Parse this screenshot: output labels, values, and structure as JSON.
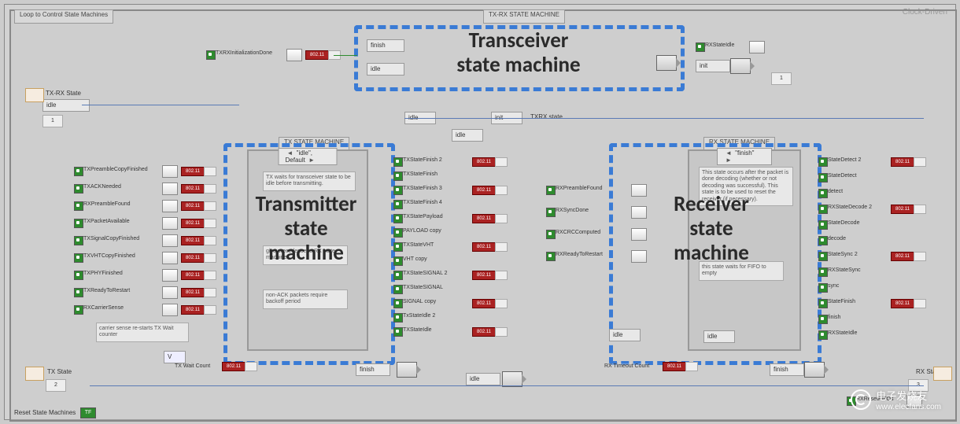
{
  "frame": {
    "title": "Loop to Control State Machines",
    "main_case": "TX-RX STATE MACHINE",
    "mode": "Clock-Driven"
  },
  "annotations": {
    "transceiver": "Transceiver\nstate machine",
    "transmitter": "Transmitter\nstate\nmachine",
    "receiver": "Receiver\nstate\nmachine"
  },
  "transceiver": {
    "input_bool": "TXRXInitializationDone",
    "out_label": "RXStateIdle",
    "finish": "finish",
    "idle": "idle",
    "init": "init"
  },
  "top_io": {
    "state_lbl": "TX-RX State",
    "state_val": "idle",
    "readout": "802.11"
  },
  "txrx_bus": {
    "label": "TXRX state",
    "idle1": "idle",
    "idle2": "idle",
    "init": "init"
  },
  "tx": {
    "case_label": "TX STATE MACHINE",
    "case_sel": "\"idle\", Default",
    "tx_state_lbl": "TX State",
    "wait_count": "TX Wait Count",
    "finish": "finish",
    "idle": "idle",
    "comment_top": "TX waits for transceiver state to be idle before transmitting.",
    "comment_mid": "give precedence to RX state machine",
    "comment_bot": "non-ACK packets require backoff period",
    "cs_comment": "carrier sense re-starts TX Wait counter",
    "inputs": [
      "TXPreambleCopyFinished",
      "TXACKNeeded",
      "RXPreambleFound",
      "TXPacketAvailable",
      "TXSignalCopyFinished",
      "TXVHTCopyFinished",
      "TXPHYFinished",
      "TXReadyToRestart",
      "RXCarrierSense"
    ],
    "outputs": [
      "TXStateFinish 2",
      "TXStateFinish",
      "TXStateFinish 3",
      "TXStateFinish 4",
      "TXStatePayload",
      "PAYLOAD copy",
      "TXStateVHT",
      "VHT copy",
      "TXStateSIGNAL 2",
      "TXStateSIGNAL",
      "SIGNAL copy",
      "TxStateIdle 2",
      "TXStateIdle"
    ],
    "readout": "802.11"
  },
  "rx": {
    "case_label": "RX STATE MACHINE",
    "case_sel": "\"finish\"",
    "comment": "This state occurs after the packet is done decoding (whether or not decoding was successful). This state is to be used to reset the receiver (if necessary).",
    "fifo_comment": "this state waits for FIFO to empty",
    "timeout_count": "RX Timeout Count",
    "rx_state_lbl": "RX State",
    "idle": "idle",
    "finish": "finish",
    "inputs": [
      "RXPreambleFound",
      "RXSyncDone",
      "RXCRCComputed",
      "RXReadyToRestart"
    ],
    "outputs": [
      "StateDetect 2",
      "StateDetect",
      "detect",
      "RXStateDecode 2",
      "StateDecode",
      "decode",
      "StateSync 2",
      "RXStateSync",
      "sync",
      "StateFinish",
      "finish",
      "RXStateIdle"
    ],
    "reset_fifos": "RXResetFIFOs",
    "readout": "802.11"
  },
  "bottom": {
    "reset_label": "Reset State Machines",
    "reset_val": "TF"
  },
  "watermark": {
    "brand_cn": "电子发烧友",
    "url": "www.elecfans.com"
  }
}
